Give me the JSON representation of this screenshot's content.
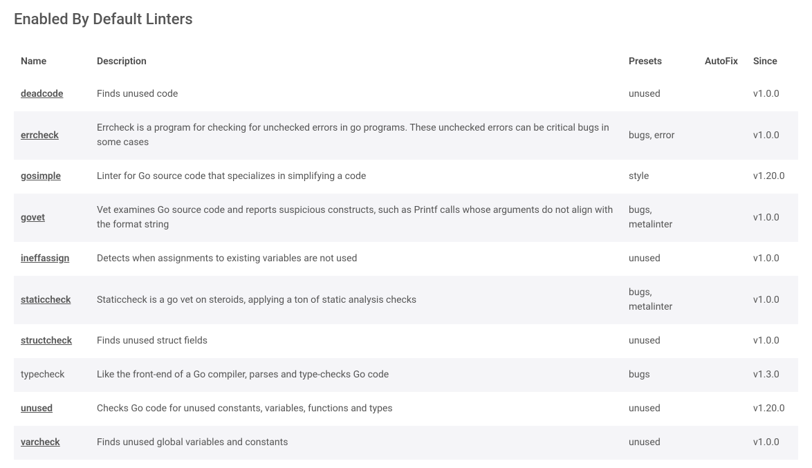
{
  "title": "Enabled By Default Linters",
  "columns": {
    "name": "Name",
    "description": "Description",
    "presets": "Presets",
    "autofix": "AutoFix",
    "since": "Since"
  },
  "rows": [
    {
      "name": "deadcode",
      "link": true,
      "description": "Finds unused code",
      "presets": "unused",
      "autofix": "",
      "since": "v1.0.0"
    },
    {
      "name": "errcheck",
      "link": true,
      "description": "Errcheck is a program for checking for unchecked errors in go programs. These unchecked errors can be critical bugs in some cases",
      "presets": "bugs, error",
      "autofix": "",
      "since": "v1.0.0"
    },
    {
      "name": "gosimple",
      "link": true,
      "description": "Linter for Go source code that specializes in simplifying a code",
      "presets": "style",
      "autofix": "",
      "since": "v1.20.0"
    },
    {
      "name": "govet",
      "link": true,
      "description": "Vet examines Go source code and reports suspicious constructs, such as Printf calls whose arguments do not align with the format string",
      "presets": "bugs, metalinter",
      "autofix": "",
      "since": "v1.0.0"
    },
    {
      "name": "ineffassign",
      "link": true,
      "description": "Detects when assignments to existing variables are not used",
      "presets": "unused",
      "autofix": "",
      "since": "v1.0.0"
    },
    {
      "name": "staticcheck",
      "link": true,
      "description": "Staticcheck is a go vet on steroids, applying a ton of static analysis checks",
      "presets": "bugs, metalinter",
      "autofix": "",
      "since": "v1.0.0"
    },
    {
      "name": "structcheck",
      "link": true,
      "description": "Finds unused struct fields",
      "presets": "unused",
      "autofix": "",
      "since": "v1.0.0"
    },
    {
      "name": "typecheck",
      "link": false,
      "description": "Like the front-end of a Go compiler, parses and type-checks Go code",
      "presets": "bugs",
      "autofix": "",
      "since": "v1.3.0"
    },
    {
      "name": "unused",
      "link": true,
      "description": "Checks Go code for unused constants, variables, functions and types",
      "presets": "unused",
      "autofix": "",
      "since": "v1.20.0"
    },
    {
      "name": "varcheck",
      "link": true,
      "description": "Finds unused global variables and constants",
      "presets": "unused",
      "autofix": "",
      "since": "v1.0.0"
    }
  ]
}
